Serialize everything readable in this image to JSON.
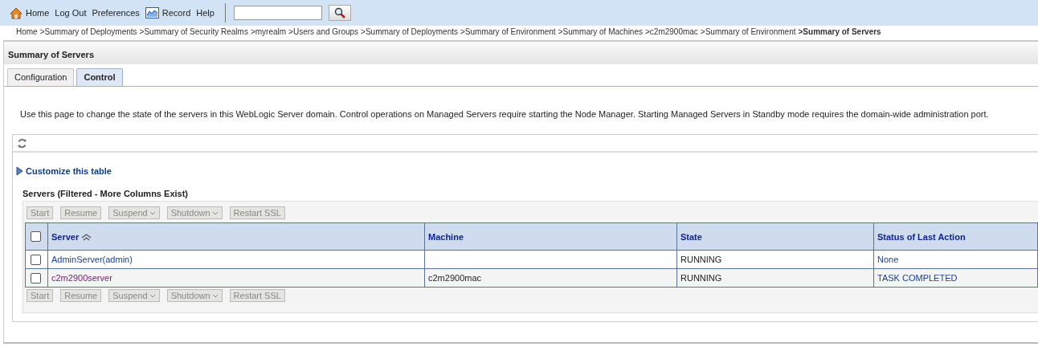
{
  "toolbar": {
    "links": [
      {
        "label": "Home",
        "kind": "home"
      },
      {
        "label": "Log Out",
        "kind": "plain"
      },
      {
        "label": "Preferences",
        "kind": "plain"
      },
      {
        "label": "Record",
        "kind": "chart"
      },
      {
        "label": "Help",
        "kind": "plain"
      }
    ]
  },
  "breadcrumb": [
    {
      "label": "Home",
      "current": false
    },
    {
      "label": ">Summary of Deployments",
      "current": false
    },
    {
      "label": ">Summary of Security Realms",
      "current": false
    },
    {
      "label": ">myrealm",
      "current": false
    },
    {
      "label": ">Users and Groups",
      "current": false
    },
    {
      "label": ">Summary of Deployments",
      "current": false
    },
    {
      "label": ">Summary of Environment",
      "current": false
    },
    {
      "label": ">Summary of Machines",
      "current": false
    },
    {
      "label": ">c2m2900mac",
      "current": false
    },
    {
      "label": ">Summary of Environment",
      "current": false
    },
    {
      "label": ">Summary of Servers",
      "current": true
    }
  ],
  "page": {
    "title": "Summary of Servers",
    "tabs": [
      {
        "label": "Configuration",
        "selected": false
      },
      {
        "label": "Control",
        "selected": true
      }
    ],
    "description": "Use this page to change the state of the servers in this WebLogic Server domain. Control operations on Managed Servers require starting the Node Manager. Starting Managed Servers in Standby mode requires the domain-wide administration port.",
    "customize_link": "Customize this table",
    "table": {
      "caption": "Servers (Filtered - More Columns Exist)",
      "top_buttons": [
        {
          "label": "Start",
          "disabled": true,
          "kind": "plain"
        },
        {
          "label": "Resume",
          "disabled": true,
          "kind": "plain"
        },
        {
          "label": "Suspend",
          "disabled": true,
          "kind": "menu"
        },
        {
          "label": "Shutdown",
          "disabled": true,
          "kind": "menu"
        },
        {
          "label": "Restart SSL",
          "disabled": true,
          "kind": "plain"
        }
      ],
      "columns": [
        {
          "label": "Server",
          "sorted": true
        },
        {
          "label": "Machine",
          "sorted": false
        },
        {
          "label": "State",
          "sorted": false
        },
        {
          "label": "Status of Last Action",
          "sorted": false
        }
      ],
      "select_all": {
        "checked": false
      },
      "rows": [
        {
          "checked": false,
          "server": "AdminServer(admin)",
          "visited": false,
          "machine": "",
          "state": "RUNNING",
          "status": "None"
        },
        {
          "checked": false,
          "server": "c2m2900server",
          "visited": true,
          "machine": "c2m2900mac",
          "state": "RUNNING",
          "status": "TASK COMPLETED"
        }
      ],
      "bottom_buttons": [
        {
          "label": "Start",
          "disabled": true,
          "kind": "plain"
        },
        {
          "label": "Resume",
          "disabled": true,
          "kind": "plain"
        },
        {
          "label": "Suspend",
          "disabled": true,
          "kind": "menu"
        },
        {
          "label": "Shutdown",
          "disabled": true,
          "kind": "menu"
        },
        {
          "label": "Restart SSL",
          "disabled": true,
          "kind": "plain"
        }
      ]
    }
  }
}
